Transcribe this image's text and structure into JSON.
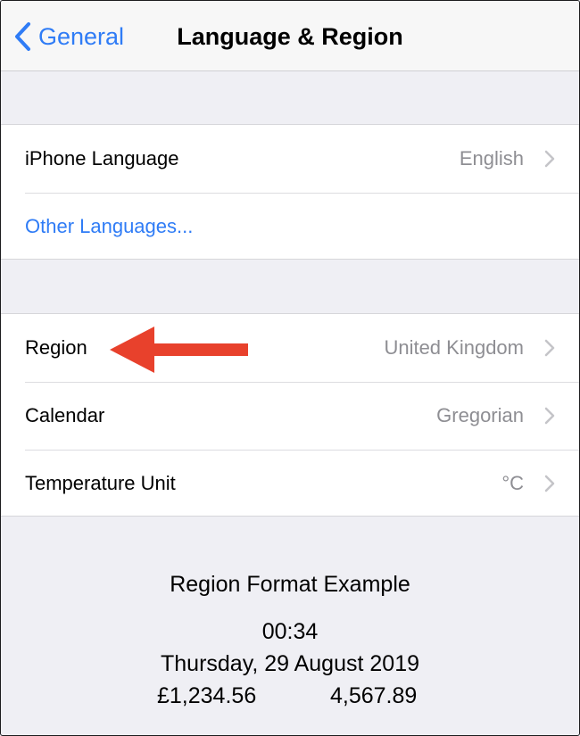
{
  "navbar": {
    "back_label": "General",
    "title": "Language & Region"
  },
  "language_group": {
    "rows": [
      {
        "label": "iPhone Language",
        "value": "English"
      },
      {
        "label": "Other Languages..."
      }
    ]
  },
  "region_group": {
    "rows": [
      {
        "label": "Region",
        "value": "United Kingdom"
      },
      {
        "label": "Calendar",
        "value": "Gregorian"
      },
      {
        "label": "Temperature Unit",
        "value": "°C"
      }
    ]
  },
  "format_example": {
    "title": "Region Format Example",
    "time": "00:34",
    "date": "Thursday, 29 August 2019",
    "currency": "£1,234.56",
    "number": "4,567.89"
  },
  "colors": {
    "accent": "#2f7cf6",
    "annotation_arrow": "#e8412c",
    "background": "#efeff4"
  },
  "icons": {
    "back": "chevron-left-icon",
    "disclosure": "chevron-right-icon",
    "annotation": "red-arrow-icon"
  }
}
